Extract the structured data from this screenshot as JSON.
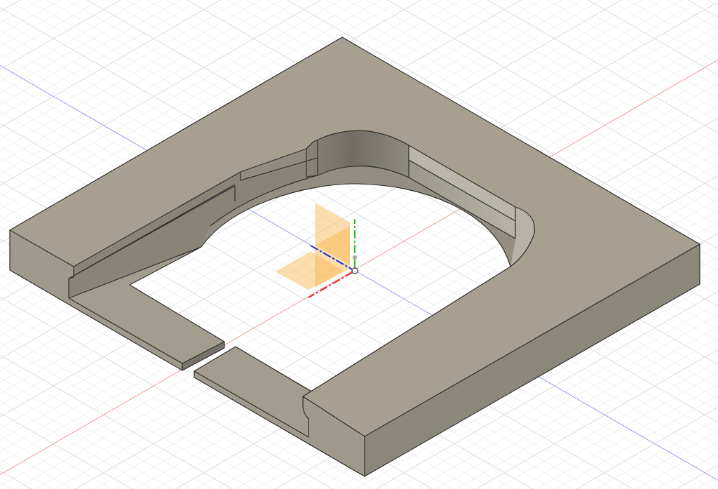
{
  "viewport": {
    "grid_visible": true,
    "world_axes_visible": true,
    "origin_visible": true
  }
}
